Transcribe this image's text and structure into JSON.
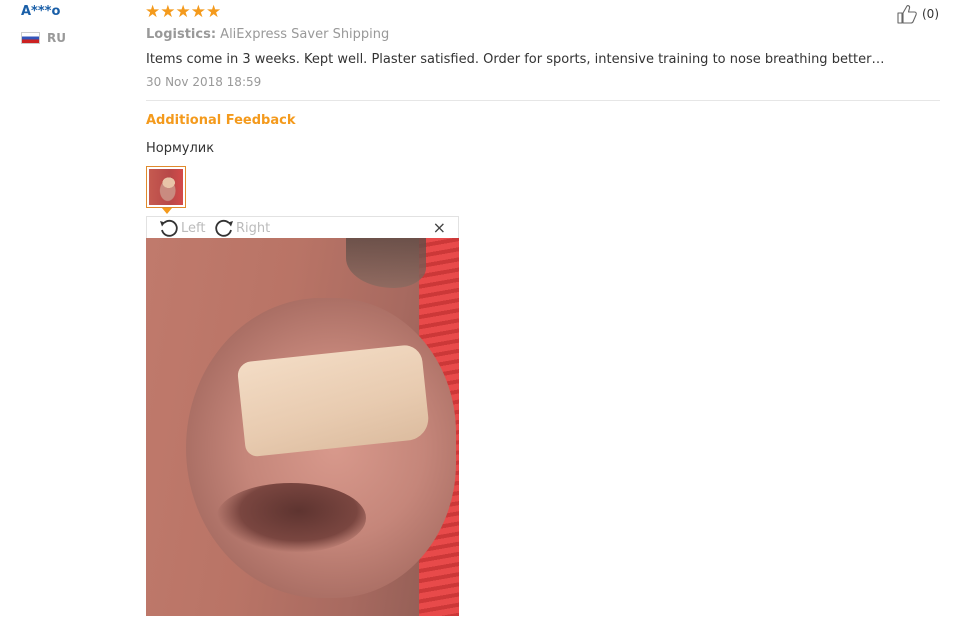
{
  "review": {
    "user_name": "A***o",
    "country_code": "RU",
    "rating": 5,
    "stars": [
      "★",
      "★",
      "★",
      "★",
      "★"
    ],
    "logistics_label": "Logistics:",
    "logistics_value": "AliExpress Saver Shipping",
    "text": "Items come in 3 weeks. Kept well. Plaster satisfied. Order for sports, intensive training to nose breathing better…",
    "date": "30 Nov 2018 18:59",
    "helpful_count": "(0)"
  },
  "additional_feedback": {
    "title": "Additional Feedback",
    "text": "Нормулик"
  },
  "image_viewer": {
    "rotate_left_label": "Left",
    "rotate_right_label": "Right",
    "close_glyph": "×"
  },
  "icons": {
    "thumbs_up": "thumbs-up-icon",
    "rotate_left": "rotate-left-icon",
    "rotate_right": "rotate-right-icon",
    "close": "close-icon"
  },
  "colors": {
    "accent": "#f49a1c",
    "username": "#1a5fa8",
    "muted": "#999999"
  }
}
